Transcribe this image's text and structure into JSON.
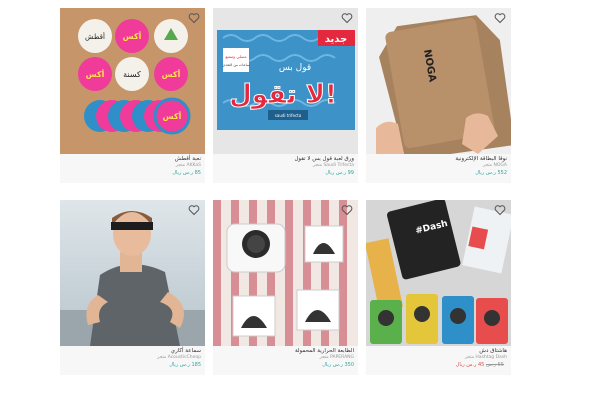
{
  "products": [
    {
      "title": "نعبة أقطش",
      "store": "AKKaS متجر",
      "price": "85 ر.س ريال",
      "image_text": [
        "أقطش",
        "أكس",
        "أكس",
        "كسنة",
        "أكس",
        "أكس"
      ]
    },
    {
      "title": "ورق لعبة قول بس لا تقول",
      "store": "Saudi Trifecta متجر",
      "price": "99 ر.س ريال",
      "image_text": [
        "جديد",
        "لا تقول!",
        "قول بس",
        "مسلي وممتع",
        "ساعات من التحدي",
        "saudi trifecta"
      ]
    },
    {
      "title": "نوقا البطاقة الإلكترونية",
      "store": "NOGA متجر",
      "price": "552 ر.س ريال",
      "image_text": [
        "NOGA"
      ]
    },
    {
      "title": "سماعة أكاري",
      "store": "AcousticCheap متجر",
      "price": "185 ر.س ريال",
      "image_text": []
    },
    {
      "title": "الطابعة الحرارية المحمولة",
      "store": "PAPERANG متجر",
      "price": "350 ر.س ريال",
      "image_text": []
    },
    {
      "title": "هاشتاق دش",
      "store": "Hashtag Dash متجر",
      "price_old": "55 ر.س",
      "price_sale": "45 ر.س ريال",
      "image_text": [
        "#Dash"
      ]
    }
  ],
  "colors": {
    "price": "#2ba7a0",
    "sale": "#e04b4b",
    "card_bg": "#f7f7f7"
  },
  "icons": {
    "favorite": "heart-outline-icon"
  }
}
